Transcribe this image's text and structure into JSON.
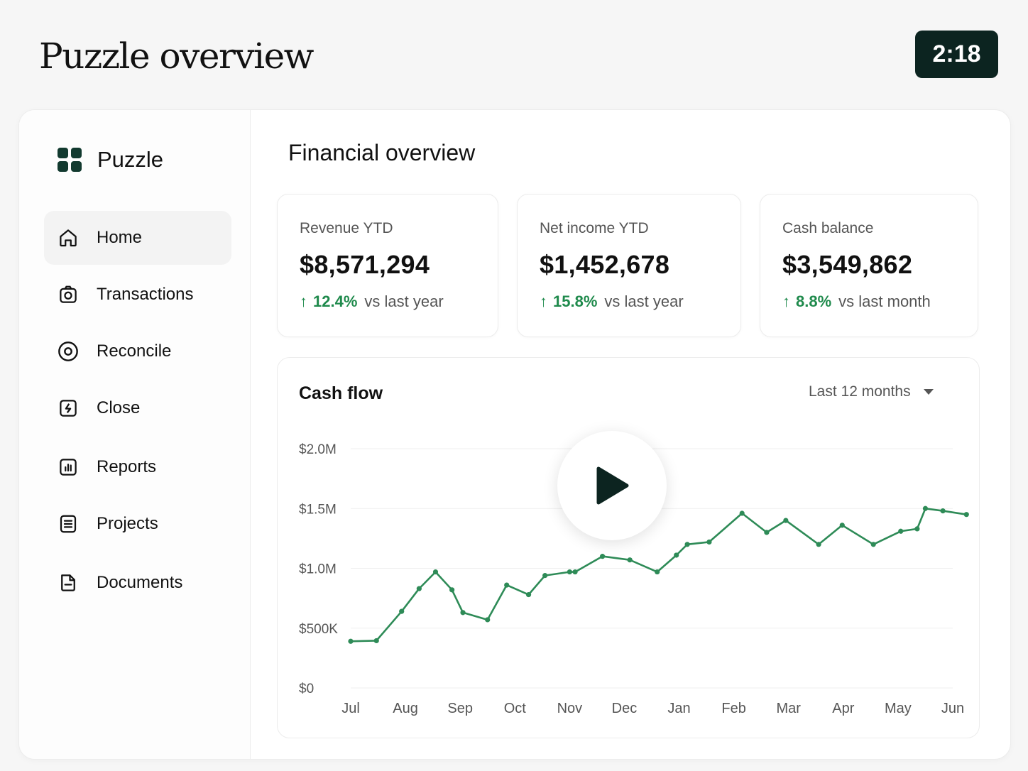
{
  "header": {
    "title": "Puzzle overview",
    "timer": "2:18"
  },
  "sidebar": {
    "brand": "Puzzle",
    "items": [
      {
        "label": "Home",
        "icon": "home-icon",
        "active": true
      },
      {
        "label": "Transactions",
        "icon": "camera-icon"
      },
      {
        "label": "Reconcile",
        "icon": "eye-icon"
      },
      {
        "label": "Close",
        "icon": "bolt-icon"
      },
      {
        "label": "Reports",
        "icon": "report-icon"
      },
      {
        "label": "Projects",
        "icon": "list-icon"
      },
      {
        "label": "Documents",
        "icon": "document-icon"
      }
    ]
  },
  "main": {
    "title": "Financial overview",
    "metrics": [
      {
        "label": "Revenue YTD",
        "value": "$8,571,294",
        "change": "12.4%",
        "comparison": "vs last year"
      },
      {
        "label": "Net income YTD",
        "value": "$1,452,678",
        "change": "15.8%",
        "comparison": "vs last year"
      },
      {
        "label": "Cash balance",
        "value": "$3,549,862",
        "change": "8.8%",
        "comparison": "vs last month"
      }
    ],
    "cashflow": {
      "title": "Cash flow",
      "range": "Last 12 months"
    }
  },
  "colors": {
    "accent": "#1f8a4c",
    "timer_bg": "#0c2420",
    "brand": "#123a2f",
    "line": "#2e8b57"
  },
  "chart_data": {
    "type": "line",
    "title": "Cash flow",
    "categories": [
      "Jul",
      "Aug",
      "Sep",
      "Oct",
      "Nov",
      "Dec",
      "Jan",
      "Feb",
      "Mar",
      "Apr",
      "May",
      "Jun"
    ],
    "y_ticks": [
      "$0",
      "$500K",
      "$1.0M",
      "$1.5M",
      "$2.0M"
    ],
    "ylim": [
      0,
      2000000
    ],
    "series": [
      {
        "x": [
          0,
          0.47,
          0.93,
          1.25,
          1.55,
          1.85,
          2.05,
          2.5,
          2.85,
          3.25,
          3.55,
          4.0,
          4.1,
          4.6,
          5.1,
          5.6,
          5.95,
          6.15,
          6.55,
          7.15,
          7.6,
          7.95,
          8.55,
          8.98,
          9.55,
          10.05,
          10.35,
          10.5,
          10.82,
          11.25
        ],
        "values": [
          390000,
          395000,
          640000,
          830000,
          970000,
          820000,
          630000,
          570000,
          860000,
          780000,
          940000,
          970000,
          970000,
          1100000,
          1070000,
          970000,
          1110000,
          1200000,
          1220000,
          1460000,
          1300000,
          1400000,
          1200000,
          1360000,
          1200000,
          1310000,
          1330000,
          1500000,
          1480000,
          1450000
        ]
      }
    ]
  }
}
